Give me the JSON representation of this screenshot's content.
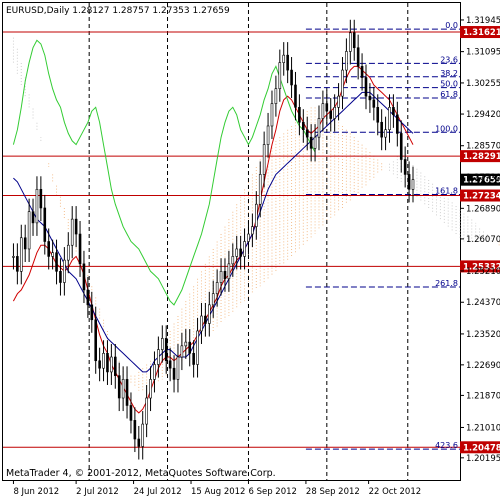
{
  "chart_data": {
    "type": "candlestick",
    "title": "EURUSD,Daily  1.28127 1.28757 1.27353 1.27659",
    "footer": "MetaTrader 4, © 2001-2012, MetaQuotes Software Corp.",
    "ylim": [
      1.196,
      1.324
    ],
    "grid": false,
    "y_ticks": [
      1.31945,
      1.31095,
      1.30255,
      1.2942,
      1.2857,
      1.2773,
      1.2689,
      1.2607,
      1.2521,
      1.2437,
      1.2352,
      1.2269,
      1.2187,
      1.2101,
      1.20195
    ],
    "y_tick_labels": [
      "1.31945",
      "1.31095",
      "1.30255",
      "1.29420",
      "1.28570",
      "1.27730",
      "1.26890",
      "1.26070",
      "1.25210",
      "1.24370",
      "1.23520",
      "1.22690",
      "1.21870",
      "1.21010",
      "1.20195"
    ],
    "x_ticks": [
      {
        "label": "8 Jun 2012",
        "day": 0
      },
      {
        "label": "2 Jul 2012",
        "day": 24
      },
      {
        "label": "24 Jul 2012",
        "day": 46
      },
      {
        "label": "15 Aug 2012",
        "day": 68
      },
      {
        "label": "6 Sep 2012",
        "day": 90
      },
      {
        "label": "28 Sep 2012",
        "day": 112
      },
      {
        "label": "22 Oct 2012",
        "day": 136
      }
    ],
    "x_range_days": [
      -4,
      171
    ],
    "vertical_separators_days": [
      29,
      59,
      90,
      120,
      151
    ],
    "horizontal_levels": [
      {
        "value": 1.31621,
        "label": "1.31621",
        "color": "#c00000"
      },
      {
        "value": 1.28291,
        "label": "1.28291",
        "color": "#c00000"
      },
      {
        "value": 1.27234,
        "label": "1.27234",
        "color": "#c00000"
      },
      {
        "value": 1.25332,
        "label": "1.25332",
        "color": "#c00000"
      },
      {
        "value": 1.20478,
        "label": "1.20478",
        "color": "#c00000"
      }
    ],
    "current_price": {
      "value": 1.27659,
      "label": "1.27659"
    },
    "fibonacci_recent": [
      {
        "label": "0.0",
        "value": 1.317
      },
      {
        "label": "23.6",
        "value": 1.3078
      },
      {
        "label": "38.2",
        "value": 1.3042
      },
      {
        "label": "50.0",
        "value": 1.3013
      },
      {
        "label": "61.8",
        "value": 1.2985
      },
      {
        "label": "100.0",
        "value": 1.2893
      },
      {
        "label": "161.8",
        "value": 1.2726
      },
      {
        "label": "261.8",
        "value": 1.2478
      },
      {
        "label": "423.6",
        "value": 1.2043
      }
    ],
    "series": [
      {
        "kind": "close",
        "color": "#000000",
        "values": [
          1.256,
          1.252,
          1.261,
          1.258,
          1.268,
          1.265,
          1.274,
          1.269,
          1.26,
          1.256,
          1.257,
          1.252,
          1.249,
          1.255,
          1.259,
          1.266,
          1.262,
          1.254,
          1.247,
          1.243,
          1.239,
          1.228,
          1.226,
          1.23,
          1.225,
          1.229,
          1.224,
          1.218,
          1.223,
          1.216,
          1.212,
          1.207,
          1.205,
          1.211,
          1.218,
          1.223,
          1.227,
          1.231,
          1.234,
          1.228,
          1.226,
          1.223,
          1.229,
          1.232,
          1.233,
          1.23,
          1.227,
          1.236,
          1.24,
          1.238,
          1.243,
          1.246,
          1.249,
          1.252,
          1.25,
          1.254,
          1.256,
          1.258,
          1.256,
          1.26,
          1.262,
          1.264,
          1.27,
          1.278,
          1.286,
          1.291,
          1.297,
          1.301,
          1.308,
          1.31,
          1.306,
          1.302,
          1.296,
          1.292,
          1.29,
          1.288,
          1.285,
          1.288,
          1.293,
          1.297,
          1.295,
          1.293,
          1.296,
          1.299,
          1.306,
          1.311,
          1.316,
          1.312,
          1.307,
          1.304,
          1.299,
          1.298,
          1.296,
          1.292,
          1.288,
          1.29,
          1.296,
          1.294,
          1.289,
          1.282,
          1.278,
          1.274,
          1.2766
        ]
      },
      {
        "kind": "tenkan",
        "color": "#d00000",
        "values": [
          1.244,
          1.246,
          1.247,
          1.249,
          1.251,
          1.254,
          1.257,
          1.259,
          1.259,
          1.258,
          1.256,
          1.254,
          1.253,
          1.252,
          1.253,
          1.255,
          1.256,
          1.254,
          1.251,
          1.247,
          1.243,
          1.239,
          1.235,
          1.232,
          1.23,
          1.227,
          1.225,
          1.223,
          1.221,
          1.219,
          1.217,
          1.215,
          1.214,
          1.215,
          1.217,
          1.22,
          1.223,
          1.226,
          1.228,
          1.229,
          1.229,
          1.228,
          1.229,
          1.23,
          1.231,
          1.232,
          1.233,
          1.235,
          1.237,
          1.239,
          1.241,
          1.243,
          1.245,
          1.248,
          1.25,
          1.251,
          1.253,
          1.255,
          1.256,
          1.258,
          1.26,
          1.262,
          1.266,
          1.271,
          1.276,
          1.281,
          1.286,
          1.29,
          1.295,
          1.298,
          1.299,
          1.298,
          1.296,
          1.294,
          1.292,
          1.29,
          1.289,
          1.29,
          1.291,
          1.293,
          1.294,
          1.295,
          1.296,
          1.298,
          1.301,
          1.304,
          1.306,
          1.307,
          1.307,
          1.306,
          1.305,
          1.304,
          1.302,
          1.301,
          1.3,
          1.299,
          1.298,
          1.296,
          1.294,
          1.292,
          1.29,
          1.288,
          1.286
        ]
      },
      {
        "kind": "kijun",
        "color": "#00008b",
        "values": [
          1.277,
          1.276,
          1.274,
          1.272,
          1.27,
          1.268,
          1.266,
          1.265,
          1.264,
          1.262,
          1.26,
          1.258,
          1.256,
          1.254,
          1.252,
          1.251,
          1.25,
          1.248,
          1.246,
          1.244,
          1.242,
          1.24,
          1.238,
          1.236,
          1.234,
          1.233,
          1.232,
          1.231,
          1.23,
          1.229,
          1.228,
          1.227,
          1.226,
          1.225,
          1.225,
          1.226,
          1.228,
          1.229,
          1.23,
          1.231,
          1.231,
          1.23,
          1.229,
          1.229,
          1.229,
          1.23,
          1.232,
          1.234,
          1.236,
          1.238,
          1.24,
          1.242,
          1.244,
          1.246,
          1.248,
          1.25,
          1.252,
          1.254,
          1.256,
          1.258,
          1.26,
          1.262,
          1.265,
          1.268,
          1.271,
          1.274,
          1.276,
          1.278,
          1.279,
          1.28,
          1.281,
          1.282,
          1.283,
          1.284,
          1.285,
          1.286,
          1.287,
          1.288,
          1.289,
          1.29,
          1.291,
          1.292,
          1.293,
          1.294,
          1.295,
          1.296,
          1.297,
          1.298,
          1.299,
          1.3,
          1.3,
          1.3,
          1.299,
          1.298,
          1.297,
          1.296,
          1.295,
          1.294,
          1.293,
          1.292,
          1.291,
          1.29,
          1.289
        ]
      },
      {
        "kind": "chikou",
        "color": "#33cc33",
        "values": [
          1.286,
          1.29,
          1.296,
          1.303,
          1.308,
          1.312,
          1.314,
          1.313,
          1.31,
          1.305,
          1.301,
          1.298,
          1.296,
          1.292,
          1.289,
          1.287,
          1.286,
          1.288,
          1.29,
          1.292,
          1.295,
          1.296,
          1.292,
          1.286,
          1.28,
          1.274,
          1.27,
          1.267,
          1.264,
          1.262,
          1.26,
          1.259,
          1.258,
          1.256,
          1.254,
          1.252,
          1.251,
          1.25,
          1.248,
          1.246,
          1.244,
          1.243,
          1.245,
          1.247,
          1.25,
          1.253,
          1.256,
          1.259,
          1.262,
          1.266,
          1.27,
          1.276,
          1.282,
          1.288,
          1.292,
          1.295,
          1.296,
          1.294,
          1.29,
          1.288,
          1.286,
          1.288,
          1.291,
          1.294,
          1.298,
          1.301,
          1.305,
          1.307,
          1.304,
          1.301,
          1.298,
          1.295,
          1.293,
          1.291,
          1.29,
          1.288,
          1.286,
          1.284
        ]
      },
      {
        "kind": "senkou_a",
        "color": "#f4a460",
        "values": [
          1.308,
          1.305,
          1.302,
          1.299,
          1.296,
          1.293,
          1.29,
          1.287,
          1.284,
          1.281,
          1.278,
          1.275,
          1.272,
          1.269,
          1.266,
          1.263,
          1.26,
          1.257,
          1.254,
          1.251,
          1.248,
          1.245,
          1.242,
          1.239,
          1.236,
          1.233,
          1.23,
          1.228,
          1.226,
          1.225,
          1.224,
          1.224,
          1.225,
          1.226,
          1.227,
          1.228,
          1.229,
          1.23,
          1.232,
          1.234,
          1.236,
          1.238,
          1.24,
          1.242,
          1.244,
          1.246,
          1.248,
          1.25,
          1.252,
          1.254,
          1.256,
          1.258,
          1.26,
          1.262,
          1.264,
          1.266,
          1.268,
          1.27,
          1.272,
          1.274,
          1.276,
          1.278,
          1.28,
          1.282,
          1.284,
          1.285,
          1.286,
          1.287,
          1.288,
          1.289,
          1.29,
          1.291,
          1.292,
          1.293,
          1.294,
          1.295,
          1.296,
          1.296,
          1.296,
          1.296,
          1.295,
          1.294,
          1.293,
          1.292,
          1.291,
          1.29,
          1.289,
          1.288,
          1.287,
          1.286,
          1.285,
          1.284,
          1.283,
          1.282,
          1.281,
          1.28,
          1.279,
          1.278,
          1.277,
          1.276,
          1.275,
          1.274,
          1.273,
          1.272,
          1.271,
          1.27,
          1.269,
          1.268,
          1.267,
          1.266,
          1.265,
          1.264,
          1.263,
          1.262,
          1.261,
          1.26,
          1.26,
          1.26,
          1.26,
          1.26,
          1.26,
          1.26,
          1.26,
          1.26,
          1.26,
          1.26,
          1.26,
          1.26
        ]
      },
      {
        "kind": "senkou_b",
        "color": "#c0c0c0",
        "values": [
          1.315,
          1.312,
          1.308,
          1.304,
          1.3,
          1.296,
          1.292,
          1.288,
          1.284,
          1.28,
          1.276,
          1.272,
          1.269,
          1.266,
          1.263,
          1.26,
          1.257,
          1.254,
          1.251,
          1.248,
          1.245,
          1.242,
          1.239,
          1.236,
          1.233,
          1.23,
          1.228,
          1.226,
          1.224,
          1.223,
          1.222,
          1.221,
          1.22,
          1.22,
          1.22,
          1.22,
          1.221,
          1.222,
          1.223,
          1.224,
          1.225,
          1.226,
          1.227,
          1.228,
          1.229,
          1.23,
          1.231,
          1.232,
          1.233,
          1.234,
          1.235,
          1.236,
          1.237,
          1.238,
          1.239,
          1.24,
          1.241,
          1.242,
          1.243,
          1.244,
          1.245,
          1.246,
          1.247,
          1.248,
          1.249,
          1.25,
          1.251,
          1.252,
          1.253,
          1.254,
          1.255,
          1.256,
          1.257,
          1.258,
          1.259,
          1.26,
          1.261,
          1.262,
          1.263,
          1.264,
          1.265,
          1.266,
          1.267,
          1.268,
          1.269,
          1.27,
          1.271,
          1.272,
          1.273,
          1.274,
          1.275,
          1.276,
          1.277,
          1.278,
          1.279,
          1.28,
          1.281,
          1.282,
          1.283,
          1.284,
          1.283,
          1.282,
          1.281,
          1.28,
          1.279,
          1.278,
          1.277,
          1.276,
          1.275,
          1.274,
          1.273,
          1.272,
          1.271,
          1.27,
          1.269,
          1.268,
          1.267,
          1.266,
          1.265,
          1.264,
          1.263,
          1.262,
          1.261,
          1.26,
          1.259,
          1.258,
          1.257,
          1.256
        ]
      }
    ]
  }
}
